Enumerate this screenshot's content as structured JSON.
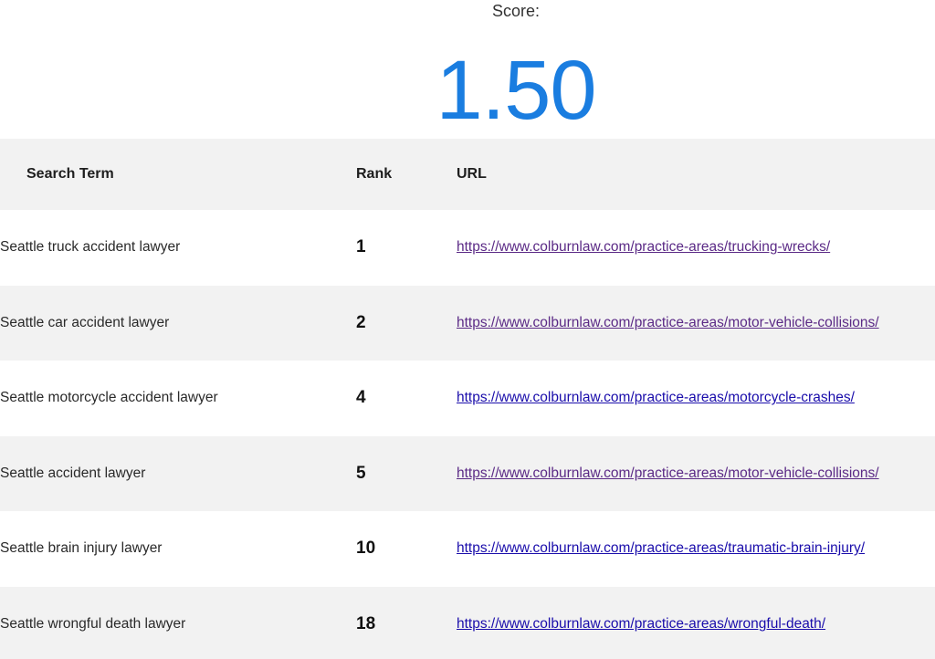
{
  "score": {
    "label": "Score:",
    "value": "1.50",
    "color": "#1a7de0"
  },
  "table": {
    "headers": {
      "term": "Search Term",
      "rank": "Rank",
      "url": "URL"
    },
    "rows": [
      {
        "term": "Seattle truck accident lawyer",
        "rank": "1",
        "url": "https://www.colburnlaw.com/practice-areas/trucking-wrecks/",
        "visited": true
      },
      {
        "term": "Seattle car accident lawyer",
        "rank": "2",
        "url": "https://www.colburnlaw.com/practice-areas/motor-vehicle-collisions/",
        "visited": true
      },
      {
        "term": "Seattle motorcycle accident lawyer",
        "rank": "4",
        "url": "https://www.colburnlaw.com/practice-areas/motorcycle-crashes/",
        "visited": false
      },
      {
        "term": "Seattle accident lawyer",
        "rank": "5",
        "url": "https://www.colburnlaw.com/practice-areas/motor-vehicle-collisions/",
        "visited": true
      },
      {
        "term": "Seattle brain injury lawyer",
        "rank": "10",
        "url": "https://www.colburnlaw.com/practice-areas/traumatic-brain-injury/",
        "visited": false
      },
      {
        "term": "Seattle wrongful death lawyer",
        "rank": "18",
        "url": "https://www.colburnlaw.com/practice-areas/wrongful-death/",
        "visited": false
      }
    ]
  },
  "colors": {
    "link": "#1a0dab",
    "link_visited": "#5b2a86",
    "row_stripe": "#f2f2f2"
  }
}
